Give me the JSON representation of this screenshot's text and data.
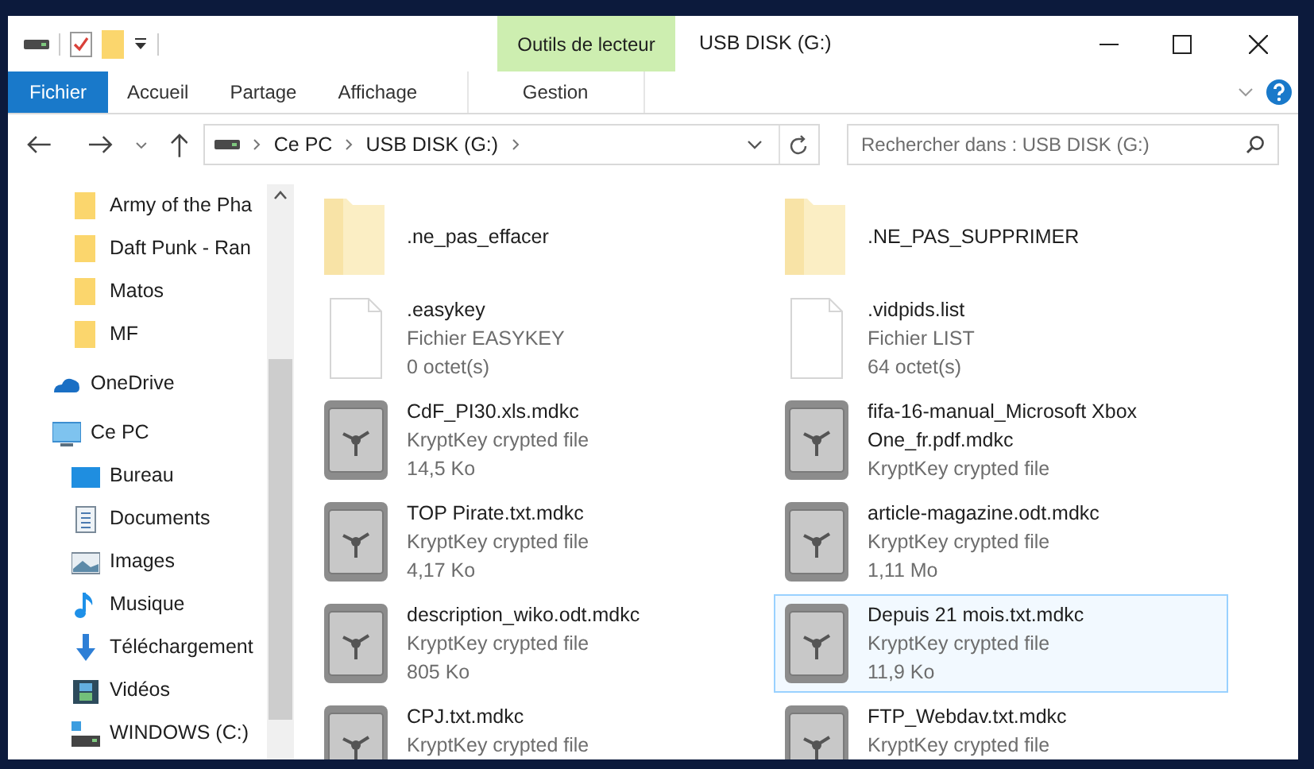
{
  "window": {
    "title": "USB DISK (G:)"
  },
  "contextual_tab_group": {
    "label": "Outils de lecteur"
  },
  "ribbon_tabs": [
    {
      "label": "Fichier",
      "kind": "file",
      "selected": false
    },
    {
      "label": "Accueil",
      "kind": "tab",
      "selected": false
    },
    {
      "label": "Partage",
      "kind": "tab",
      "selected": false
    },
    {
      "label": "Affichage",
      "kind": "tab",
      "selected": false
    },
    {
      "label": "Gestion",
      "kind": "contextual",
      "selected": false
    }
  ],
  "address_bar": {
    "segments": [
      "Ce PC",
      "USB DISK (G:)"
    ]
  },
  "search": {
    "placeholder": "Rechercher dans : USB DISK (G:)"
  },
  "navigation": {
    "items": [
      {
        "kind": "folder",
        "label": "Army of the Pha"
      },
      {
        "kind": "folder",
        "label": "Daft Punk - Ran"
      },
      {
        "kind": "folder",
        "label": "Matos"
      },
      {
        "kind": "folder",
        "label": "MF"
      },
      {
        "kind": "onedrive",
        "label": "OneDrive"
      },
      {
        "kind": "pc",
        "label": "Ce PC",
        "children": [
          {
            "kind": "desktop",
            "label": "Bureau"
          },
          {
            "kind": "documents",
            "label": "Documents"
          },
          {
            "kind": "images",
            "label": "Images"
          },
          {
            "kind": "music",
            "label": "Musique"
          },
          {
            "kind": "downloads",
            "label": "Téléchargement"
          },
          {
            "kind": "videos",
            "label": "Vidéos"
          },
          {
            "kind": "drive",
            "label": "WINDOWS (C:)"
          }
        ]
      }
    ]
  },
  "files": [
    {
      "kind": "folder",
      "name": ".ne_pas_effacer",
      "selected": false
    },
    {
      "kind": "folder",
      "name": ".NE_PAS_SUPPRIMER",
      "selected": false
    },
    {
      "kind": "file",
      "name": ".easykey",
      "type": "Fichier EASYKEY",
      "size": "0 octet(s)",
      "selected": false
    },
    {
      "kind": "file",
      "name": ".vidpids.list",
      "type": "Fichier LIST",
      "size": "64 octet(s)",
      "selected": false
    },
    {
      "kind": "crypted",
      "name": "CdF_PI30.xls.mdkc",
      "type": "KryptKey crypted file",
      "size": "14,5 Ko",
      "selected": false
    },
    {
      "kind": "crypted",
      "name": "fifa-16-manual_Microsoft Xbox One_fr.pdf.mdkc",
      "type": "KryptKey crypted file",
      "selected": false
    },
    {
      "kind": "crypted",
      "name": "TOP Pirate.txt.mdkc",
      "type": "KryptKey crypted file",
      "size": "4,17 Ko",
      "selected": false
    },
    {
      "kind": "crypted",
      "name": "article-magazine.odt.mdkc",
      "type": "KryptKey crypted file",
      "size": "1,11 Mo",
      "selected": false
    },
    {
      "kind": "crypted",
      "name": "description_wiko.odt.mdkc",
      "type": "KryptKey crypted file",
      "size": "805 Ko",
      "selected": false
    },
    {
      "kind": "crypted",
      "name": "Depuis 21 mois.txt.mdkc",
      "type": "KryptKey crypted file",
      "size": "11,9 Ko",
      "selected": true
    },
    {
      "kind": "crypted",
      "name": "CPJ.txt.mdkc",
      "type": "KryptKey crypted file",
      "selected": false
    },
    {
      "kind": "crypted",
      "name": "FTP_Webdav.txt.mdkc",
      "type": "KryptKey crypted file",
      "selected": false
    }
  ]
}
